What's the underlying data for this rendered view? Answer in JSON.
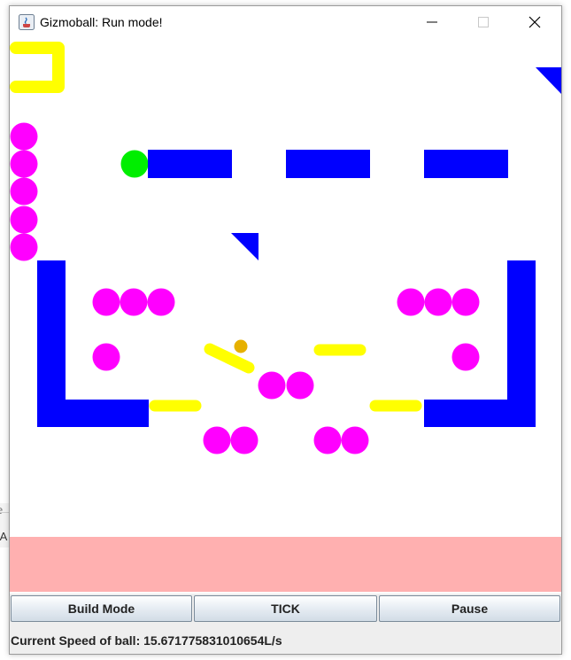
{
  "window": {
    "title": "Gizmoball: Run mode!",
    "controls": {
      "minimize": "minimize-icon",
      "maximize": "maximize-icon",
      "close": "close-icon"
    }
  },
  "background_window": {
    "snippet_top": "e",
    "snippet_bottom": "\\A"
  },
  "board": {
    "colors": {
      "square_bumper": "#0000ff",
      "circle_bumper": "#ff00ff",
      "flipper": "#ffff00",
      "ball": "#e6b000",
      "hit_circle": "#00ee00",
      "absorber": "#ffb0b0"
    }
  },
  "buttons": {
    "build_mode": "Build Mode",
    "tick": "TICK",
    "pause": "Pause"
  },
  "status": {
    "speed_text": "Current Speed of ball: 15.671775831010654L/s"
  }
}
